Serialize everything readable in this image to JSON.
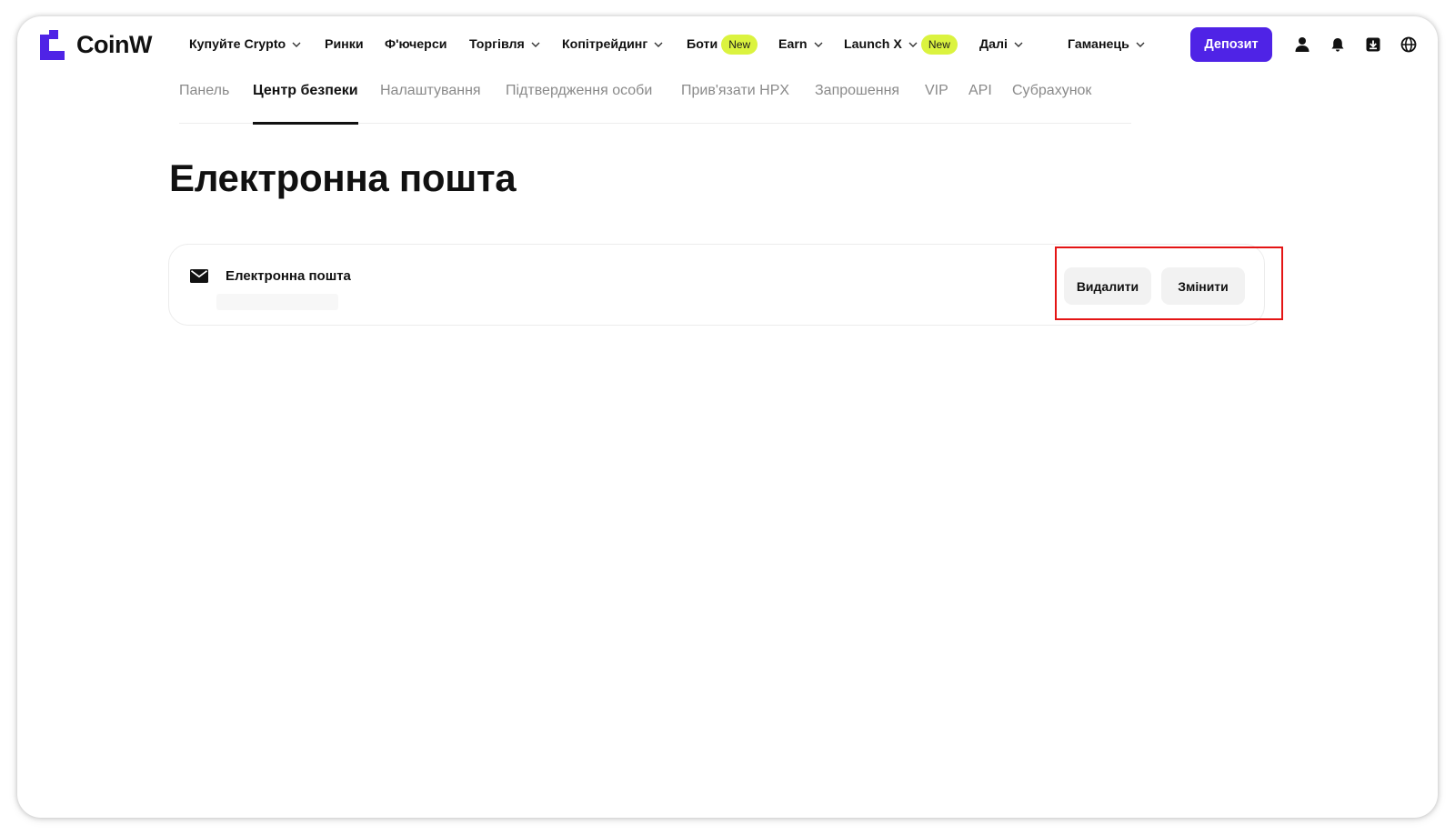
{
  "brand": {
    "name": "CoinW",
    "accent_color": "#4f23e6",
    "badge_color": "#dbf33f",
    "highlight_color": "#e41414"
  },
  "nav": {
    "items": [
      {
        "label": "Купуйте Crypto",
        "dropdown": true
      },
      {
        "label": "Ринки",
        "dropdown": false
      },
      {
        "label": "Ф'ючерси",
        "dropdown": false
      },
      {
        "label": "Торгівля",
        "dropdown": true
      },
      {
        "label": "Копітрейдинг",
        "dropdown": true
      },
      {
        "label": "Боти",
        "dropdown": false,
        "badge": "New"
      },
      {
        "label": "Earn",
        "dropdown": true
      },
      {
        "label": "Launch X",
        "dropdown": true,
        "badge": "New"
      },
      {
        "label": "Далі",
        "dropdown": true
      }
    ],
    "wallet_label": "Гаманець",
    "deposit_label": "Депозит",
    "icons": [
      "user-icon",
      "bell-icon",
      "download-icon",
      "globe-icon"
    ]
  },
  "subtabs": {
    "items": [
      {
        "label": "Панель",
        "active": false
      },
      {
        "label": "Центр безпеки",
        "active": true
      },
      {
        "label": "Налаштування",
        "active": false
      },
      {
        "label": "Підтвердження особи",
        "active": false
      },
      {
        "label": "Прив'язати HPX",
        "active": false
      },
      {
        "label": "Запрошення",
        "active": false
      },
      {
        "label": "VIP",
        "active": false
      },
      {
        "label": "API",
        "active": false
      },
      {
        "label": "Субрахунок",
        "active": false
      }
    ]
  },
  "page": {
    "title": "Електронна пошта"
  },
  "email_card": {
    "icon": "mail-icon",
    "label": "Електронна пошта",
    "delete_label": "Видалити",
    "change_label": "Змінити"
  }
}
